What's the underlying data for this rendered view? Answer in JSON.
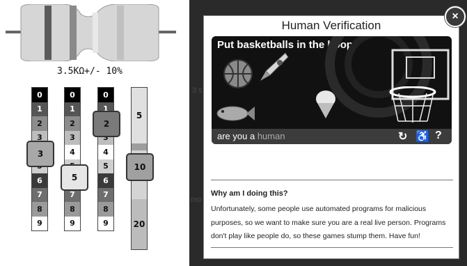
{
  "calculator": {
    "value_readout": "3.5KΩ+/- 10%",
    "colors": [
      "#000000",
      "#555555",
      "#8c8c8c",
      "#bdbdbd",
      "#ffffff",
      "#cfcfcf",
      "#3a3a3a",
      "#6e6e6e",
      "#9a9a9a",
      "#ffffff"
    ],
    "digits": [
      "0",
      "1",
      "2",
      "3",
      "4",
      "5",
      "6",
      "7",
      "8",
      "9"
    ],
    "band1_selected": "3",
    "band2_selected": "5",
    "multiplier_selected": "2",
    "tolerance_top": "5",
    "tolerance_selected": "10",
    "tolerance_bottom": "20"
  },
  "background_text": {
    "fragment_1": "3 s",
    "fragment_2": "mo"
  },
  "modal": {
    "title": "Human Verification",
    "close_label": "×",
    "game_prompt": "Put basketballs in the hoop",
    "brand_prefix": "are you a",
    "brand_suffix": "human",
    "refresh_icon": "↻",
    "accessibility_icon": "♿",
    "help_icon": "?",
    "why_heading": "Why am I doing this?",
    "why_body": "Unfortunately, some people use automated programs for malicious purposes, so we want to make sure you are a real live person. Programs don't play like people do, so these games stump them. Have fun!"
  }
}
